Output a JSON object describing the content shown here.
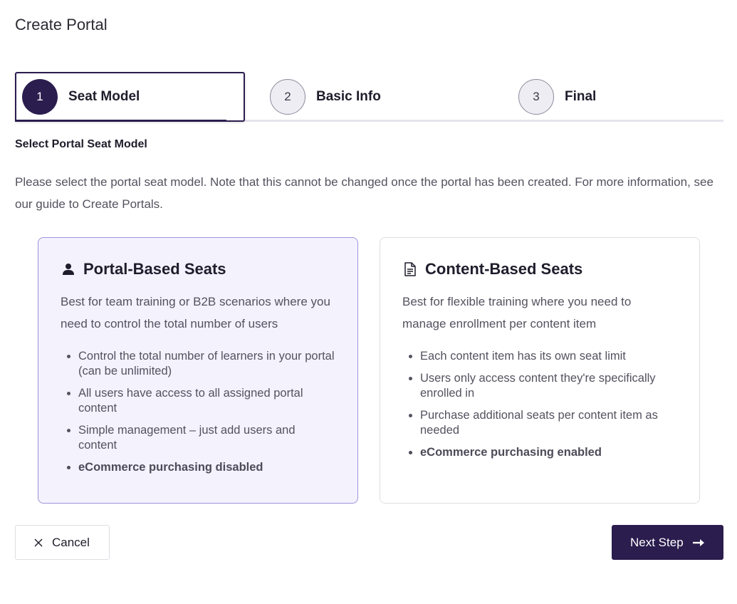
{
  "page": {
    "title": "Create Portal"
  },
  "stepper": {
    "steps": [
      {
        "number": "1",
        "label": "Seat Model",
        "state": "active"
      },
      {
        "number": "2",
        "label": "Basic Info",
        "state": "inactive"
      },
      {
        "number": "3",
        "label": "Final",
        "state": "inactive"
      }
    ]
  },
  "section": {
    "heading": "Select Portal Seat Model",
    "intro": "Please select the portal seat model. Note that this cannot be changed once the portal has been created. For more information, see our guide to Create Portals."
  },
  "cards": [
    {
      "icon": "user-icon",
      "title": "Portal-Based Seats",
      "description": "Best for team training or B2B scenarios where you need to control the total number of users",
      "selected": true,
      "features": [
        "Control the total number of learners in your portal (can be unlimited)",
        "All users have access to all assigned portal content",
        "Simple management – just add users and content",
        "eCommerce purchasing disabled"
      ]
    },
    {
      "icon": "document-icon",
      "title": "Content-Based Seats",
      "description": "Best for flexible training where you need to manage enrollment per content item",
      "selected": false,
      "features": [
        "Each content item has its own seat limit",
        "Users only access content they're specifically enrolled in",
        "Purchase additional seats per content item as needed",
        "eCommerce purchasing enabled"
      ]
    }
  ],
  "actions": {
    "cancel_label": "Cancel",
    "next_label": "Next Step"
  },
  "colors": {
    "primary": "#2b1d4e",
    "selected_card_bg": "#f4f2fd",
    "selected_card_border": "#9c94dc"
  }
}
